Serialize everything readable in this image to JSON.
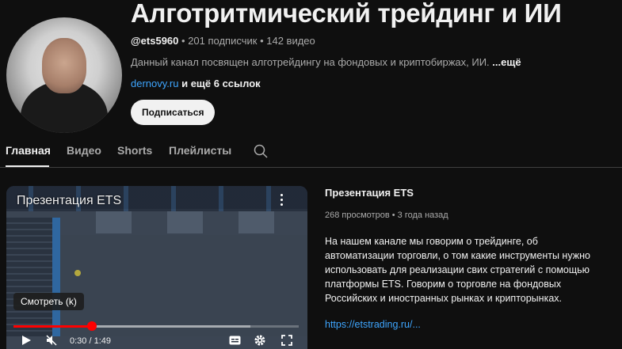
{
  "channel": {
    "title": "Алготритмический трейдинг и ИИ",
    "handle": "@ets5960",
    "subscribers": "201 подписчик",
    "videos": "142 видео",
    "description": "Данный канал посвящен алготрейдингу на фондовых и криптобиржах, ИИ.",
    "more_label": "...ещё",
    "link": "dernovy.ru",
    "more_links": "и ещё 6 ссылок",
    "subscribe_label": "Подписаться"
  },
  "tabs": [
    {
      "label": "Главная",
      "active": true
    },
    {
      "label": "Видео",
      "active": false
    },
    {
      "label": "Shorts",
      "active": false
    },
    {
      "label": "Плейлисты",
      "active": false
    }
  ],
  "player": {
    "title": "Презентация ETS",
    "tooltip": "Смотреть (k)",
    "time_current": "0:30",
    "time_total": "1:49",
    "time_display": "0:30 / 1:49",
    "progress_fraction": 0.275,
    "buffered_fraction": 0.83
  },
  "featured": {
    "title": "Презентация ETS",
    "views": "268 просмотров",
    "age": "3 года назад",
    "description_lines": [
      "На нашем канале мы говорим о трейдинге, об",
      "автоматизации торговли, о том какие инструменты нужно",
      "использовать для реализации свих стратегий с помощью",
      "платформы ETS. Говорим о торговле на фондовых",
      "Российских и иностранных рынках и крипторынках."
    ],
    "link": "https://etstrading.ru/..."
  },
  "colors": {
    "accent_red": "#ff0000",
    "link_blue": "#3ea6ff",
    "background": "#0f0f0f"
  }
}
